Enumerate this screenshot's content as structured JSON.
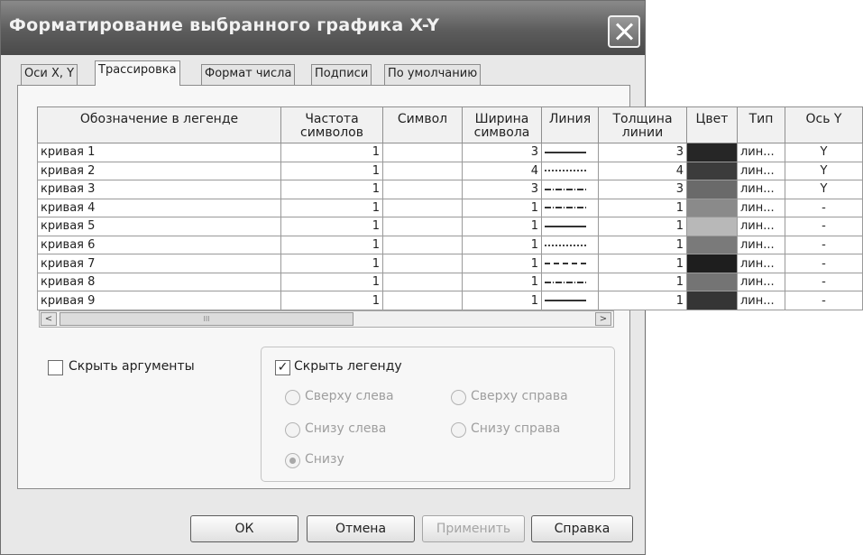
{
  "window": {
    "title": "Форматирование выбранного графика X-Y"
  },
  "tabs": [
    "Оси X, Y",
    "Трассировка",
    "Формат числа",
    "Подписи",
    "По умолчанию"
  ],
  "active_tab": "Трассировка",
  "table": {
    "headers": [
      "Обозначение в легенде",
      "Частота символов",
      "Символ",
      "Ширина символа",
      "Линия",
      "Толщина линии",
      "Цвет",
      "Тип",
      "Ось Y"
    ],
    "rows": [
      {
        "name": "кривая 1",
        "freq": "1",
        "symbol": "",
        "width": "3",
        "line": "solid",
        "thick": "3",
        "color": "#262626",
        "type": "лин...",
        "axis": "Y"
      },
      {
        "name": "кривая 2",
        "freq": "1",
        "symbol": "",
        "width": "4",
        "line": "dotted",
        "thick": "4",
        "color": "#3c3c3c",
        "type": "лин...",
        "axis": "Y"
      },
      {
        "name": "кривая 3",
        "freq": "1",
        "symbol": "",
        "width": "3",
        "line": "dashdot",
        "thick": "3",
        "color": "#6a6a6a",
        "type": "лин...",
        "axis": "Y"
      },
      {
        "name": "кривая 4",
        "freq": "1",
        "symbol": "",
        "width": "1",
        "line": "dashdot",
        "thick": "1",
        "color": "#8a8a8a",
        "type": "лин...",
        "axis": "-"
      },
      {
        "name": "кривая 5",
        "freq": "1",
        "symbol": "",
        "width": "1",
        "line": "solid",
        "thick": "1",
        "color": "#b8b8b8",
        "type": "лин...",
        "axis": "-"
      },
      {
        "name": "кривая 6",
        "freq": "1",
        "symbol": "",
        "width": "1",
        "line": "dotted",
        "thick": "1",
        "color": "#7a7a7a",
        "type": "лин...",
        "axis": "-"
      },
      {
        "name": "кривая 7",
        "freq": "1",
        "symbol": "",
        "width": "1",
        "line": "dashed",
        "thick": "1",
        "color": "#1e1e1e",
        "type": "лин...",
        "axis": "-"
      },
      {
        "name": "кривая 8",
        "freq": "1",
        "symbol": "",
        "width": "1",
        "line": "dashdot",
        "thick": "1",
        "color": "#747474",
        "type": "лин...",
        "axis": "-"
      },
      {
        "name": "кривая 9",
        "freq": "1",
        "symbol": "",
        "width": "1",
        "line": "solid",
        "thick": "1",
        "color": "#353535",
        "type": "лин...",
        "axis": "-"
      }
    ]
  },
  "scrollbar": {
    "left_arrow": "<",
    "right_arrow": ">",
    "thumb_grip": "III"
  },
  "options": {
    "hide_args": {
      "label": "Скрыть аргументы",
      "checked": false
    },
    "hide_legend": {
      "label": "Скрыть легенду",
      "checked": true,
      "check_mark": "✓"
    }
  },
  "legend_positions": [
    {
      "label": "Сверху слева",
      "selected": false
    },
    {
      "label": "Сверху справа",
      "selected": false
    },
    {
      "label": "Снизу слева",
      "selected": false
    },
    {
      "label": "Снизу справа",
      "selected": false
    },
    {
      "label": "Снизу",
      "selected": true
    }
  ],
  "buttons": {
    "ok": "ОК",
    "cancel": "Отмена",
    "apply": "Применить",
    "help": "Справка"
  }
}
